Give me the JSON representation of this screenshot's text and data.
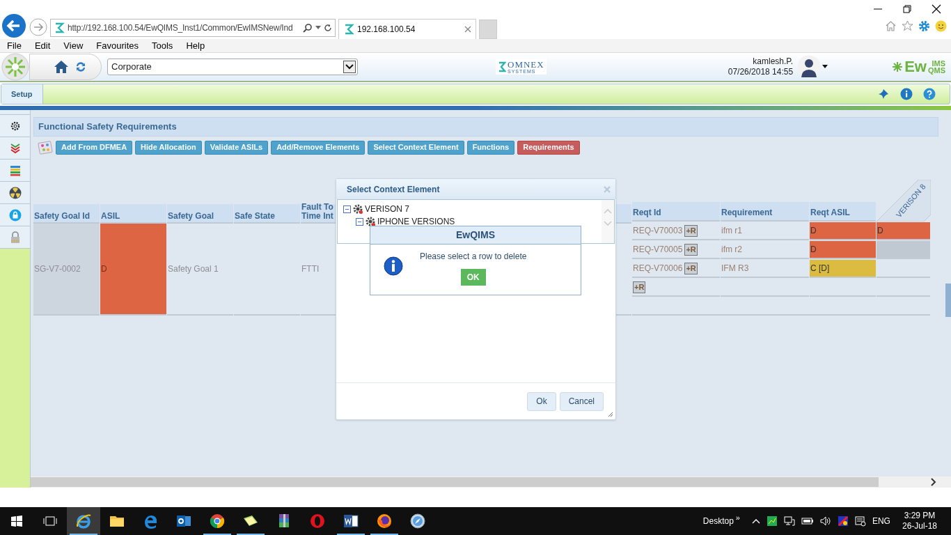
{
  "browser": {
    "address": "http://192.168.100.54/EwQIMS_Inst1/Common/EwIMSNew/Ind",
    "tabs": [
      {
        "title": "192.168.100.54",
        "selected": true
      }
    ],
    "menu": [
      "File",
      "Edit",
      "View",
      "Favourites",
      "Tools",
      "Help"
    ]
  },
  "app_header": {
    "site": "Corporate",
    "logo_name": "OMNEX",
    "logo_tagline": "SYSTEMS",
    "user": "kamlesh.P.",
    "datetime": "07/26/2018 14:55",
    "brand": "Ew",
    "brand_top": "IMS",
    "brand_bottom": "QMS"
  },
  "nav_tabs": [
    {
      "label": "Setup",
      "selected": true
    }
  ],
  "sidebar": [
    {
      "kind": "gear",
      "selected": false
    },
    {
      "kind": "chevrons",
      "selected": false
    },
    {
      "kind": "stack",
      "selected": false
    },
    {
      "kind": "radiation",
      "selected": false
    },
    {
      "kind": "lock",
      "selected": false
    },
    {
      "kind": "padlock",
      "selected": false
    }
  ],
  "panel": {
    "title": "Functional Safety Requirements",
    "toolbar": [
      {
        "label": "Add From DFMEA",
        "selected": false
      },
      {
        "label": "Hide Allocation",
        "selected": false
      },
      {
        "label": "Validate ASILs",
        "selected": false
      },
      {
        "label": "Add/Remove Elements",
        "selected": false
      },
      {
        "label": "Select Context Element",
        "selected": false
      },
      {
        "label": "Functions",
        "selected": false
      },
      {
        "label": "Requirements",
        "selected": true
      }
    ]
  },
  "table": {
    "left_columns": [
      {
        "header": "Safety Goal Id",
        "value": "SG-V7-0002",
        "color": "#cdd6df"
      },
      {
        "header": "ASIL",
        "value": "D",
        "color": "#dd6543"
      },
      {
        "header": "Safety Goal",
        "value": "Safety Goal 1",
        "color": "#dfe8f0"
      },
      {
        "header": "Safe State",
        "color": "#dfe8f0"
      },
      {
        "header": "Fault To Time Int",
        "value": "FTTI",
        "color": "#dfe8f0"
      }
    ],
    "right_headers": [
      "Reqt Id",
      "Requirement",
      "Reqt ASIL"
    ],
    "version_header": "VERISON 8",
    "rows": [
      {
        "reqt_id": "REQ-V70003",
        "add": "+R",
        "requirement": "ifm r1",
        "asil": {
          "value": "D",
          "color": "#dd6543"
        },
        "version": {
          "value": "D",
          "color": "#dd6543"
        }
      },
      {
        "reqt_id": "REQ-V70005",
        "add": "+R",
        "requirement": "ifm r2",
        "asil": {
          "value": "D",
          "color": "#dd6543"
        },
        "version": {
          "color": "#c0c9d1"
        }
      },
      {
        "reqt_id": "REQ-V70006",
        "add": "+R",
        "requirement": "IFM R3",
        "asil": {
          "value": "C [D]",
          "color": "#dcbc40"
        }
      },
      {
        "add": "+R"
      }
    ]
  },
  "context_dialog": {
    "title": "Select Context Element",
    "tree": [
      {
        "label": "VERISON 7",
        "expanded": true,
        "children": [
          {
            "label": "IPHONE VERSIONS",
            "expanded": true
          }
        ]
      }
    ],
    "buttons": [
      "Ok",
      "Cancel"
    ]
  },
  "alert": {
    "title": "EwQIMS",
    "message": "Please select a row to delete",
    "button": "OK"
  },
  "taskbar": {
    "apps": [
      {
        "kind": "ie",
        "selected": true,
        "running": true
      },
      {
        "kind": "folder",
        "selected": false,
        "running": false
      },
      {
        "kind": "edge",
        "selected": false,
        "running": false
      },
      {
        "kind": "outlook",
        "selected": false,
        "running": false
      },
      {
        "kind": "chrome",
        "selected": false,
        "running": true
      },
      {
        "kind": "notes",
        "selected": false,
        "running": true
      },
      {
        "kind": "winrar",
        "selected": false,
        "running": false
      },
      {
        "kind": "opera",
        "selected": false,
        "running": false
      },
      {
        "kind": "word",
        "selected": false,
        "running": true
      },
      {
        "kind": "firefox",
        "selected": false,
        "running": true
      },
      {
        "kind": "compass",
        "selected": false,
        "running": false
      }
    ],
    "desktop": "Desktop",
    "chevron": "»",
    "language": "ENG",
    "time": "3:29 PM",
    "date": "26-Jul-18"
  }
}
